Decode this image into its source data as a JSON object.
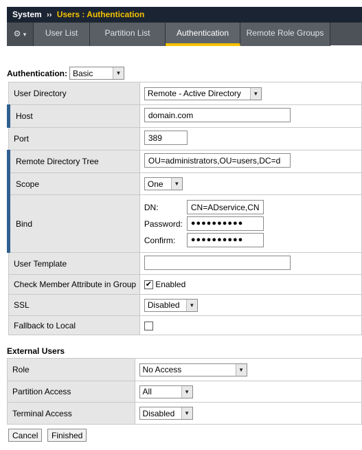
{
  "breadcrumb": {
    "root": "System",
    "separator": "››",
    "current": "Users : Authentication"
  },
  "tabs": [
    {
      "label": "User List",
      "active": false
    },
    {
      "label": "Partition List",
      "active": false
    },
    {
      "label": "Authentication",
      "active": true
    },
    {
      "label": "Remote Role Groups",
      "active": false
    }
  ],
  "gear_menu": {
    "icon": "gear-icon",
    "caret": "▾"
  },
  "authentication": {
    "label": "Authentication:",
    "value": "Basic"
  },
  "form": {
    "user_directory": {
      "label": "User Directory",
      "value": "Remote - Active Directory"
    },
    "host": {
      "label": "Host",
      "value": "domain.com"
    },
    "port": {
      "label": "Port",
      "value": "389"
    },
    "remote_directory_tree": {
      "label": "Remote Directory Tree",
      "value": "OU=administrators,OU=users,DC=d"
    },
    "scope": {
      "label": "Scope",
      "value": "One"
    },
    "bind": {
      "label": "Bind",
      "dn_label": "DN:",
      "dn_value": "CN=ADservice,CN",
      "password_label": "Password:",
      "password_value": "●●●●●●●●●●",
      "confirm_label": "Confirm:",
      "confirm_value": "●●●●●●●●●●"
    },
    "user_template": {
      "label": "User Template",
      "value": ""
    },
    "check_member": {
      "label": "Check Member Attribute in Group",
      "checked": true,
      "option": "Enabled",
      "check": "✔"
    },
    "ssl": {
      "label": "SSL",
      "value": "Disabled"
    },
    "fallback": {
      "label": "Fallback to Local",
      "checked": false
    }
  },
  "external_users": {
    "title": "External Users",
    "role": {
      "label": "Role",
      "value": "No Access"
    },
    "partition_access": {
      "label": "Partition Access",
      "value": "All"
    },
    "terminal_access": {
      "label": "Terminal Access",
      "value": "Disabled"
    }
  },
  "buttons": {
    "cancel": "Cancel",
    "finished": "Finished"
  },
  "colors": {
    "header_bg": "#1b2433",
    "accent": "#f5c200",
    "required_marker": "#2f5f8f"
  }
}
